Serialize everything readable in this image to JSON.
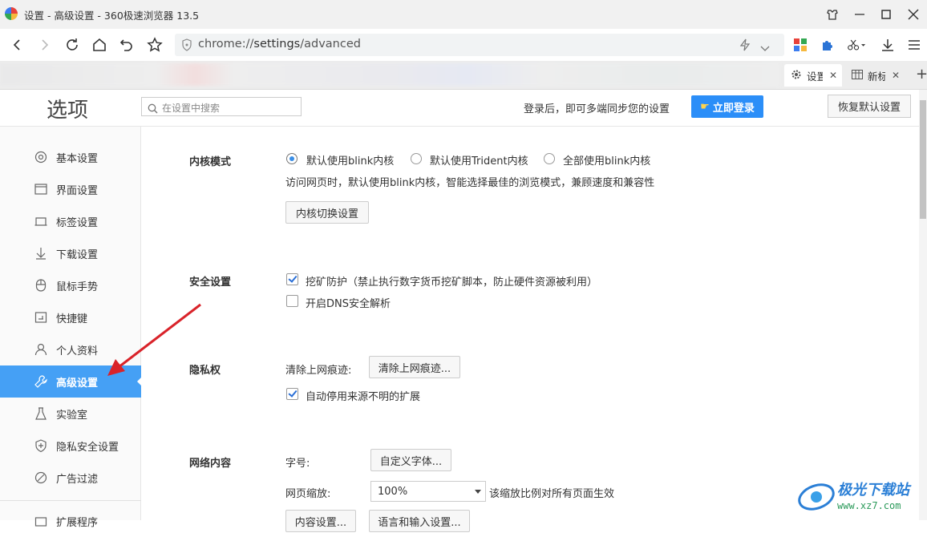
{
  "window": {
    "title": "设置 - 高级设置 - 360极速浏览器 13.5"
  },
  "toolbar": {
    "url_scheme": "chrome://",
    "url_host": "settings",
    "url_path": "/advanced"
  },
  "tabs": [
    {
      "label": "设置"
    },
    {
      "label": "新标"
    }
  ],
  "header": {
    "page_title": "选项",
    "search_placeholder": "在设置中搜索",
    "sync_text": "登录后，即可多端同步您的设置",
    "login_label": "立即登录",
    "restore_label": "恢复默认设置"
  },
  "sidebar": {
    "items": [
      {
        "label": "基本设置"
      },
      {
        "label": "界面设置"
      },
      {
        "label": "标签设置"
      },
      {
        "label": "下载设置"
      },
      {
        "label": "鼠标手势"
      },
      {
        "label": "快捷键"
      },
      {
        "label": "个人资料"
      },
      {
        "label": "高级设置"
      },
      {
        "label": "实验室"
      },
      {
        "label": "隐私安全设置"
      },
      {
        "label": "广告过滤"
      },
      {
        "label": "扩展程序"
      }
    ],
    "active_index": 7
  },
  "kernel": {
    "title": "内核模式",
    "options": [
      "默认使用blink内核",
      "默认使用Trident内核",
      "全部使用blink内核"
    ],
    "selected": 0,
    "desc": "访问网页时，默认使用blink内核，智能选择最佳的浏览模式，兼顾速度和兼容性",
    "switch_button": "内核切换设置"
  },
  "security": {
    "title": "安全设置",
    "mining": {
      "label": "挖矿防护（禁止执行数字货币挖矿脚本，防止硬件资源被利用）",
      "checked": true
    },
    "dns": {
      "label": "开启DNS安全解析",
      "checked": false
    }
  },
  "privacy": {
    "title": "隐私权",
    "clear_label": "清除上网痕迹:",
    "clear_button": "清除上网痕迹...",
    "auto_disable": {
      "label": "自动停用来源不明的扩展",
      "checked": true
    }
  },
  "network": {
    "title": "网络内容",
    "font_label": "字号:",
    "font_button": "自定义字体...",
    "zoom_label": "网页缩放:",
    "zoom_value": "100%",
    "zoom_note": "该缩放比例对所有页面生效",
    "content_button": "内容设置...",
    "lang_button": "语言和输入设置..."
  },
  "watermark": {
    "brand": "极光下载站",
    "site": "www.xz7.com"
  },
  "colors": {
    "accent": "#2b8ef8",
    "sidebar_active": "#45a0f5",
    "arrow": "#d9232a"
  }
}
